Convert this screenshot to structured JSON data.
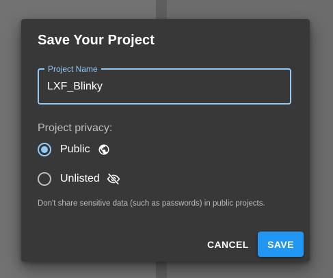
{
  "dialog": {
    "title": "Save Your Project",
    "project_name": {
      "label": "Project Name",
      "value": "LXF_Blinky"
    },
    "privacy": {
      "label": "Project privacy:",
      "options": [
        {
          "label": "Public",
          "icon": "globe-icon",
          "selected": true
        },
        {
          "label": "Unlisted",
          "icon": "eye-off-icon",
          "selected": false
        }
      ]
    },
    "hint": "Don't share sensitive data (such as passwords) in public projects.",
    "cancel_label": "CANCEL",
    "save_label": "SAVE"
  },
  "colors": {
    "accent": "#90caf9",
    "primary_button": "#2196f3",
    "dialog_background": "#383838"
  }
}
